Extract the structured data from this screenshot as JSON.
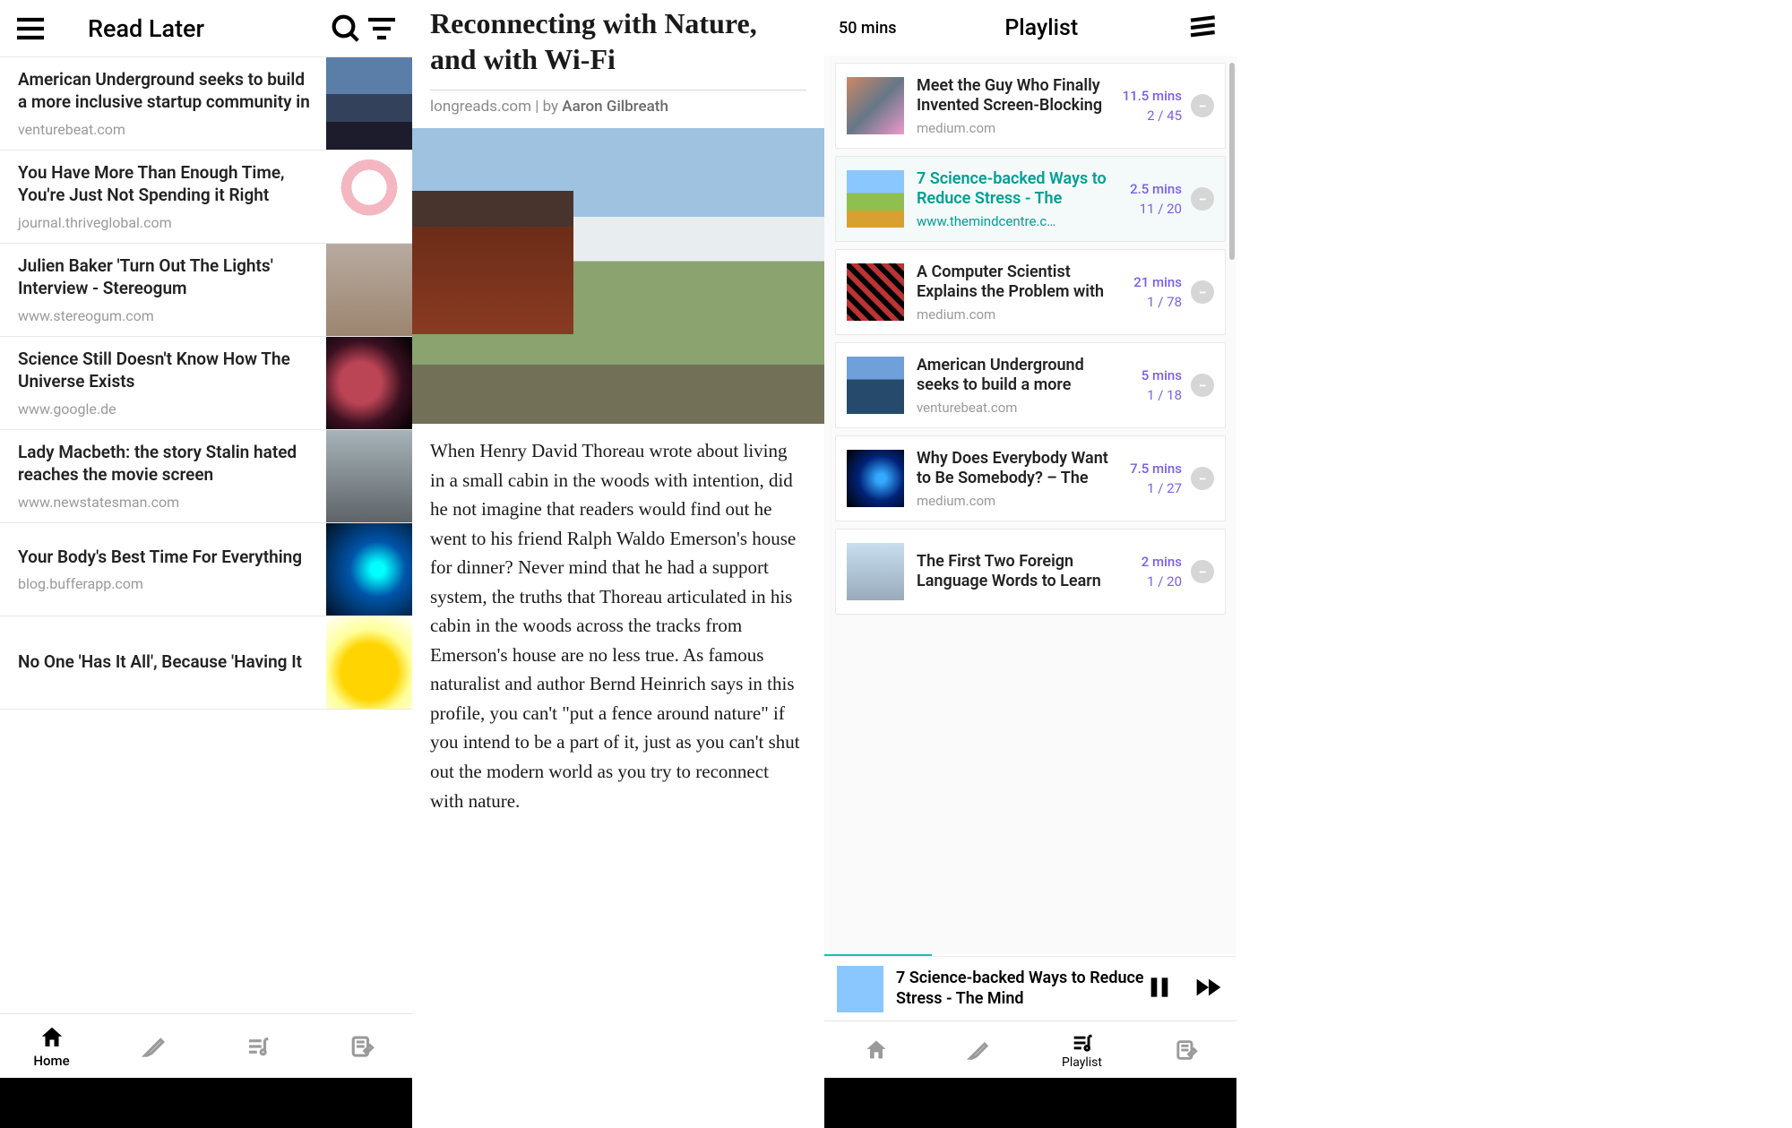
{
  "readLater": {
    "title": "Read Later",
    "tabs": {
      "home": "Home"
    },
    "items": [
      {
        "title": "American Underground seeks to build a more inclusive startup community in",
        "source": "venturebeat.com"
      },
      {
        "title": "You Have More Than Enough Time, You're Just Not Spending it Right",
        "source": "journal.thriveglobal.com"
      },
      {
        "title": "Julien Baker 'Turn Out The Lights' Interview - Stereogum",
        "source": "www.stereogum.com"
      },
      {
        "title": "Science Still Doesn't Know How The Universe Exists",
        "source": "www.google.de"
      },
      {
        "title": "Lady Macbeth: the story Stalin hated reaches the movie screen",
        "source": "www.newstatesman.com"
      },
      {
        "title": "Your Body's Best Time For Everything",
        "source": "blog.bufferapp.com"
      },
      {
        "title": "No One 'Has It All', Because 'Having It",
        "source": ""
      }
    ]
  },
  "article": {
    "title": "Reconnecting with Nature, and with Wi-Fi",
    "domain": "longreads.com",
    "byPrefix": " | by ",
    "author": "Aaron Gilbreath",
    "body": "When Henry David Thoreau wrote about living in a small cabin in the woods with intention, did he not imagine that readers would find out he went to his friend Ralph Waldo Emerson's house for dinner? Never mind that he had a support system, the truths that Thoreau articulated in his cabin in the woods across the tracks from Emerson's house are no less true. As famous naturalist and author Bernd Heinrich says in this profile, you can't \"put a fence around nature\" if you intend to be a part of it, just as you can't shut out the modern world as you try to reconnect with nature."
  },
  "playlist": {
    "duration": "50 mins",
    "title": "Playlist",
    "tabLabel": "Playlist",
    "nowPlaying": "7 Science-backed Ways to Reduce Stress - The Mind",
    "items": [
      {
        "title": "Meet the Guy Who Finally Invented Screen-Blocking",
        "source": "medium.com",
        "mins": "11.5 mins",
        "progress": "2 / 45"
      },
      {
        "title": "7 Science-backed Ways to Reduce Stress - The",
        "source": "www.themindcentre.c…",
        "mins": "2.5 mins",
        "progress": "11 / 20",
        "active": true
      },
      {
        "title": "A Computer Scientist Explains the Problem with",
        "source": "medium.com",
        "mins": "21 mins",
        "progress": "1 / 78"
      },
      {
        "title": "American Underground seeks to build a more",
        "source": "venturebeat.com",
        "mins": "5 mins",
        "progress": "1 / 18"
      },
      {
        "title": "Why Does Everybody Want to Be Somebody? – The",
        "source": "medium.com",
        "mins": "7.5 mins",
        "progress": "1 / 27"
      },
      {
        "title": "The First Two Foreign Language Words to Learn",
        "source": "",
        "mins": "2 mins",
        "progress": "1 / 20"
      }
    ]
  }
}
